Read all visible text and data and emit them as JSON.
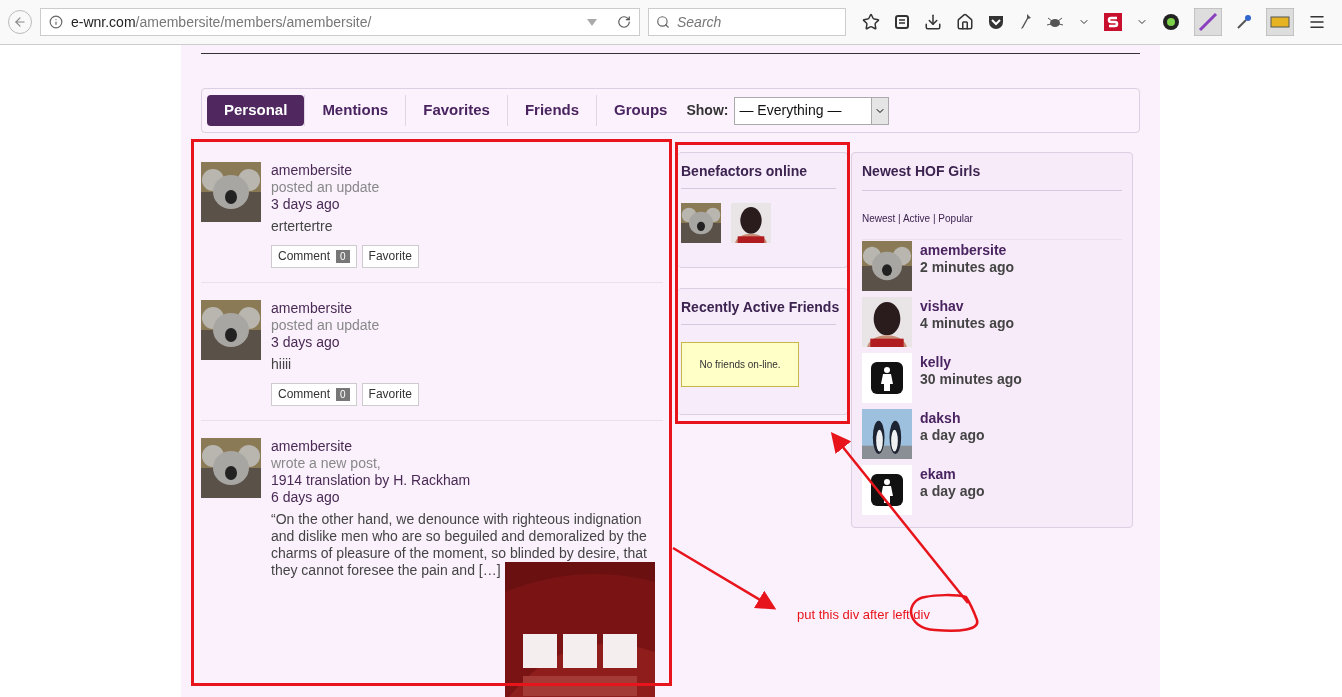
{
  "browser": {
    "url_domain": "e-wnr.com",
    "url_path": "/amembersite/members/amembersite/",
    "search_placeholder": "Search"
  },
  "tabs": [
    {
      "label": "Personal",
      "selected": true
    },
    {
      "label": "Mentions",
      "selected": false
    },
    {
      "label": "Favorites",
      "selected": false
    },
    {
      "label": "Friends",
      "selected": false
    },
    {
      "label": "Groups",
      "selected": false
    }
  ],
  "show": {
    "label": "Show:",
    "value": "— Everything —"
  },
  "activity": [
    {
      "user": "amembersite",
      "action": "posted an update",
      "time": "3 days ago",
      "content": "ertertertre",
      "comment_label": "Comment",
      "comment_count": "0",
      "favorite_label": "Favorite"
    },
    {
      "user": "amembersite",
      "action": "posted an update",
      "time": "3 days ago",
      "content": "hiiii",
      "comment_label": "Comment",
      "comment_count": "0",
      "favorite_label": "Favorite"
    },
    {
      "user": "amembersite",
      "action": "wrote a new post,",
      "title": "1914 translation by H. Rackham",
      "time": "6 days ago",
      "excerpt": "“On the other hand, we denounce with righteous indignation and dislike men who are so beguiled and demoralized by the charms of pleasure of the moment, so blinded by desire, that they cannot foresee the pain and […]"
    }
  ],
  "benefactors": {
    "title": "Benefactors online",
    "avatars": [
      {
        "kind": "koala"
      },
      {
        "kind": "person"
      }
    ]
  },
  "friends": {
    "title": "Recently Active Friends",
    "empty_message": "No friends on-line."
  },
  "hof": {
    "title": "Newest HOF Girls",
    "filters": "Newest | Active | Popular",
    "members": [
      {
        "name": "amembersite",
        "time": "2 minutes ago",
        "kind": "koala"
      },
      {
        "name": "vishav",
        "time": "4 minutes ago",
        "kind": "person"
      },
      {
        "name": "kelly",
        "time": "30 minutes ago",
        "kind": "icon"
      },
      {
        "name": "daksh",
        "time": "a day ago",
        "kind": "penguins"
      },
      {
        "name": "ekam",
        "time": "a day ago",
        "kind": "icon"
      }
    ]
  },
  "annotation": {
    "note": "put this div after left div"
  }
}
